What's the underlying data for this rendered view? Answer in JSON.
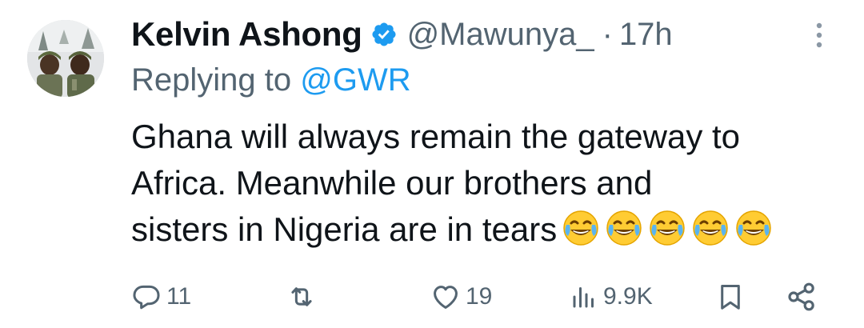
{
  "author": {
    "display_name": "Kelvin Ashong",
    "handle": "@Mawunya_",
    "separator": "·",
    "time": "17h",
    "verified": true,
    "verified_color": "#1d9bf0"
  },
  "reply": {
    "prefix": "Replying to",
    "mention": "@GWR"
  },
  "tweet": {
    "lines": [
      "Ghana will always remain the gateway to",
      "Africa. Meanwhile our brothers and",
      "sisters in Nigeria are in tears"
    ],
    "emojis": [
      "face-with-tears-of-joy",
      "face-with-tears-of-joy",
      "face-with-tears-of-joy",
      "face-with-tears-of-joy",
      "face-with-tears-of-joy"
    ]
  },
  "actions": {
    "reply_count": "11",
    "retweet_count": "",
    "like_count": "19",
    "views_count": "9.9K"
  },
  "colors": {
    "text_primary": "#0f1419",
    "text_secondary": "#536471",
    "accent": "#1d9bf0"
  },
  "icons": [
    "more-icon",
    "verified-badge-icon",
    "reply-icon",
    "retweet-icon",
    "like-icon",
    "views-icon",
    "bookmark-icon",
    "share-icon"
  ]
}
